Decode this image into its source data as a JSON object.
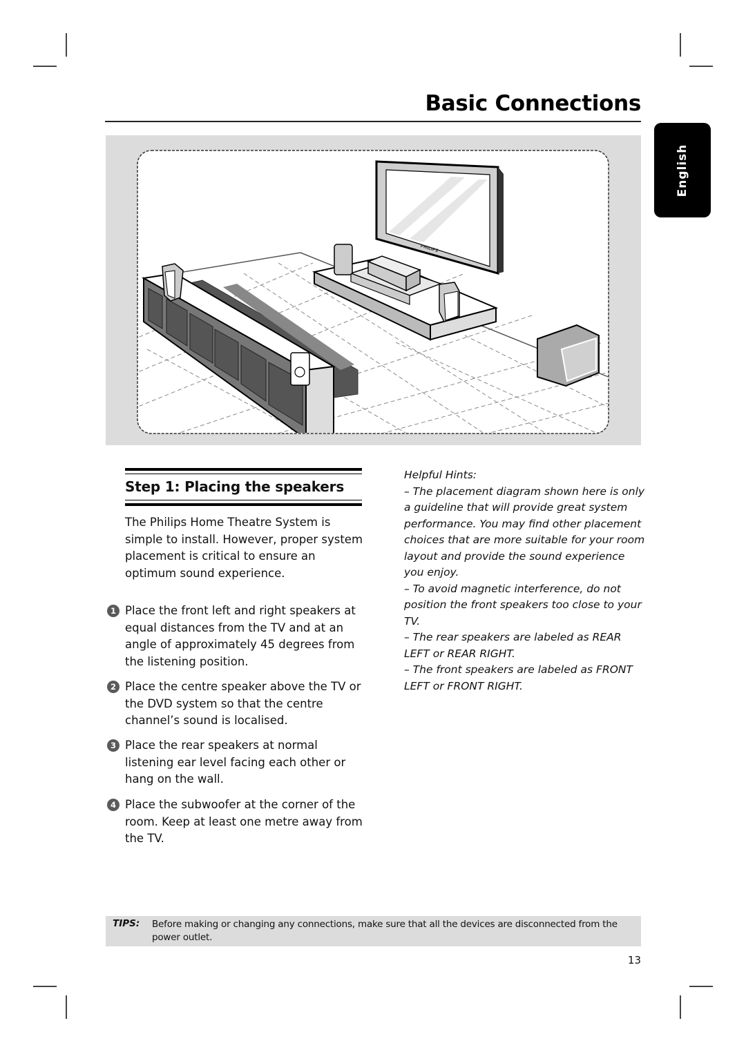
{
  "header": {
    "title": "Basic Connections",
    "language_tab": "English"
  },
  "diagram": {
    "description": "Home theatre speaker placement illustration",
    "tv_brand_label": "PHILIPS",
    "colors": {
      "panel_background": "#dcdcdc",
      "sofa": "#555555",
      "speaker": "#c8c8c8"
    }
  },
  "step": {
    "heading": "Step 1:  Placing the speakers",
    "intro": "The Philips Home Theatre System is simple to install.  However, proper system placement is critical to ensure an optimum sound experience.",
    "items": [
      {
        "number": "1",
        "text": "Place the front left and right speakers at equal distances from the TV and at an angle of approximately 45 degrees from the listening position."
      },
      {
        "number": "2",
        "text": "Place the centre speaker above the TV or the DVD system so that the centre channel’s sound is localised."
      },
      {
        "number": "3",
        "text": "Place the rear speakers at normal listening ear level facing each other or hang on the wall."
      },
      {
        "number": "4",
        "text": "Place the subwoofer at the corner of the room.  Keep at least one metre away from the TV."
      }
    ]
  },
  "hints": {
    "title": "Helpful Hints:",
    "items": [
      "– The placement diagram shown here is only a guideline that will provide great system performance.  You may find other placement choices that are more suitable for your room layout and provide the sound experience you enjoy.",
      "– To avoid magnetic interference, do not position the front speakers too close to your TV.",
      "– The rear speakers are labeled as REAR LEFT or REAR RIGHT.",
      "– The front speakers are labeled as FRONT LEFT or FRONT RIGHT."
    ]
  },
  "tips": {
    "label": "TIPS:",
    "text": "Before making or changing any connections, make sure that all the devices are disconnected from the power outlet."
  },
  "footer": {
    "page_number": "13"
  }
}
